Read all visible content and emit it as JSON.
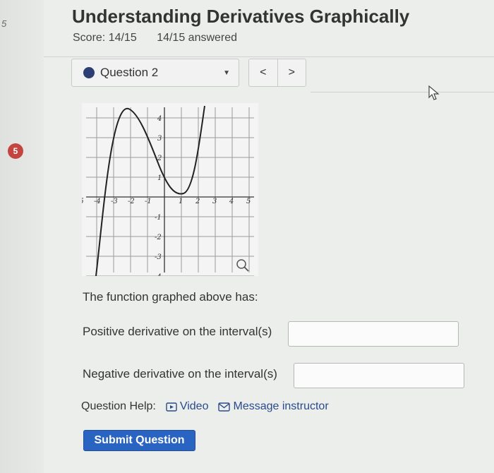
{
  "sidebar": {
    "mark": "5",
    "badge": "5"
  },
  "header": {
    "title": "Understanding Derivatives Graphically",
    "score": "Score: 14/15",
    "answered": "14/15 answered"
  },
  "question_nav": {
    "selected": "Question 2",
    "prev_label": "<",
    "next_label": ">"
  },
  "graph": {
    "x_ticks": [
      "-5",
      "-4",
      "-3",
      "-2",
      "-1",
      "1",
      "2",
      "3",
      "4",
      "5"
    ],
    "y_ticks": [
      "4",
      "3",
      "2",
      "1",
      "-1",
      "-2",
      "-3",
      "-4"
    ]
  },
  "question": {
    "prompt": "The function graphed above has:",
    "positive_label": "Positive derivative on the interval(s)",
    "positive_value": "",
    "negative_label": "Negative derivative on the interval(s)",
    "negative_value": ""
  },
  "help": {
    "label": "Question Help:",
    "video": "Video",
    "message": "Message instructor"
  },
  "submit_label": "Submit Question",
  "colors": {
    "submit": "#2a64c2",
    "badge": "#c4453f",
    "link": "#2a4a8c"
  }
}
